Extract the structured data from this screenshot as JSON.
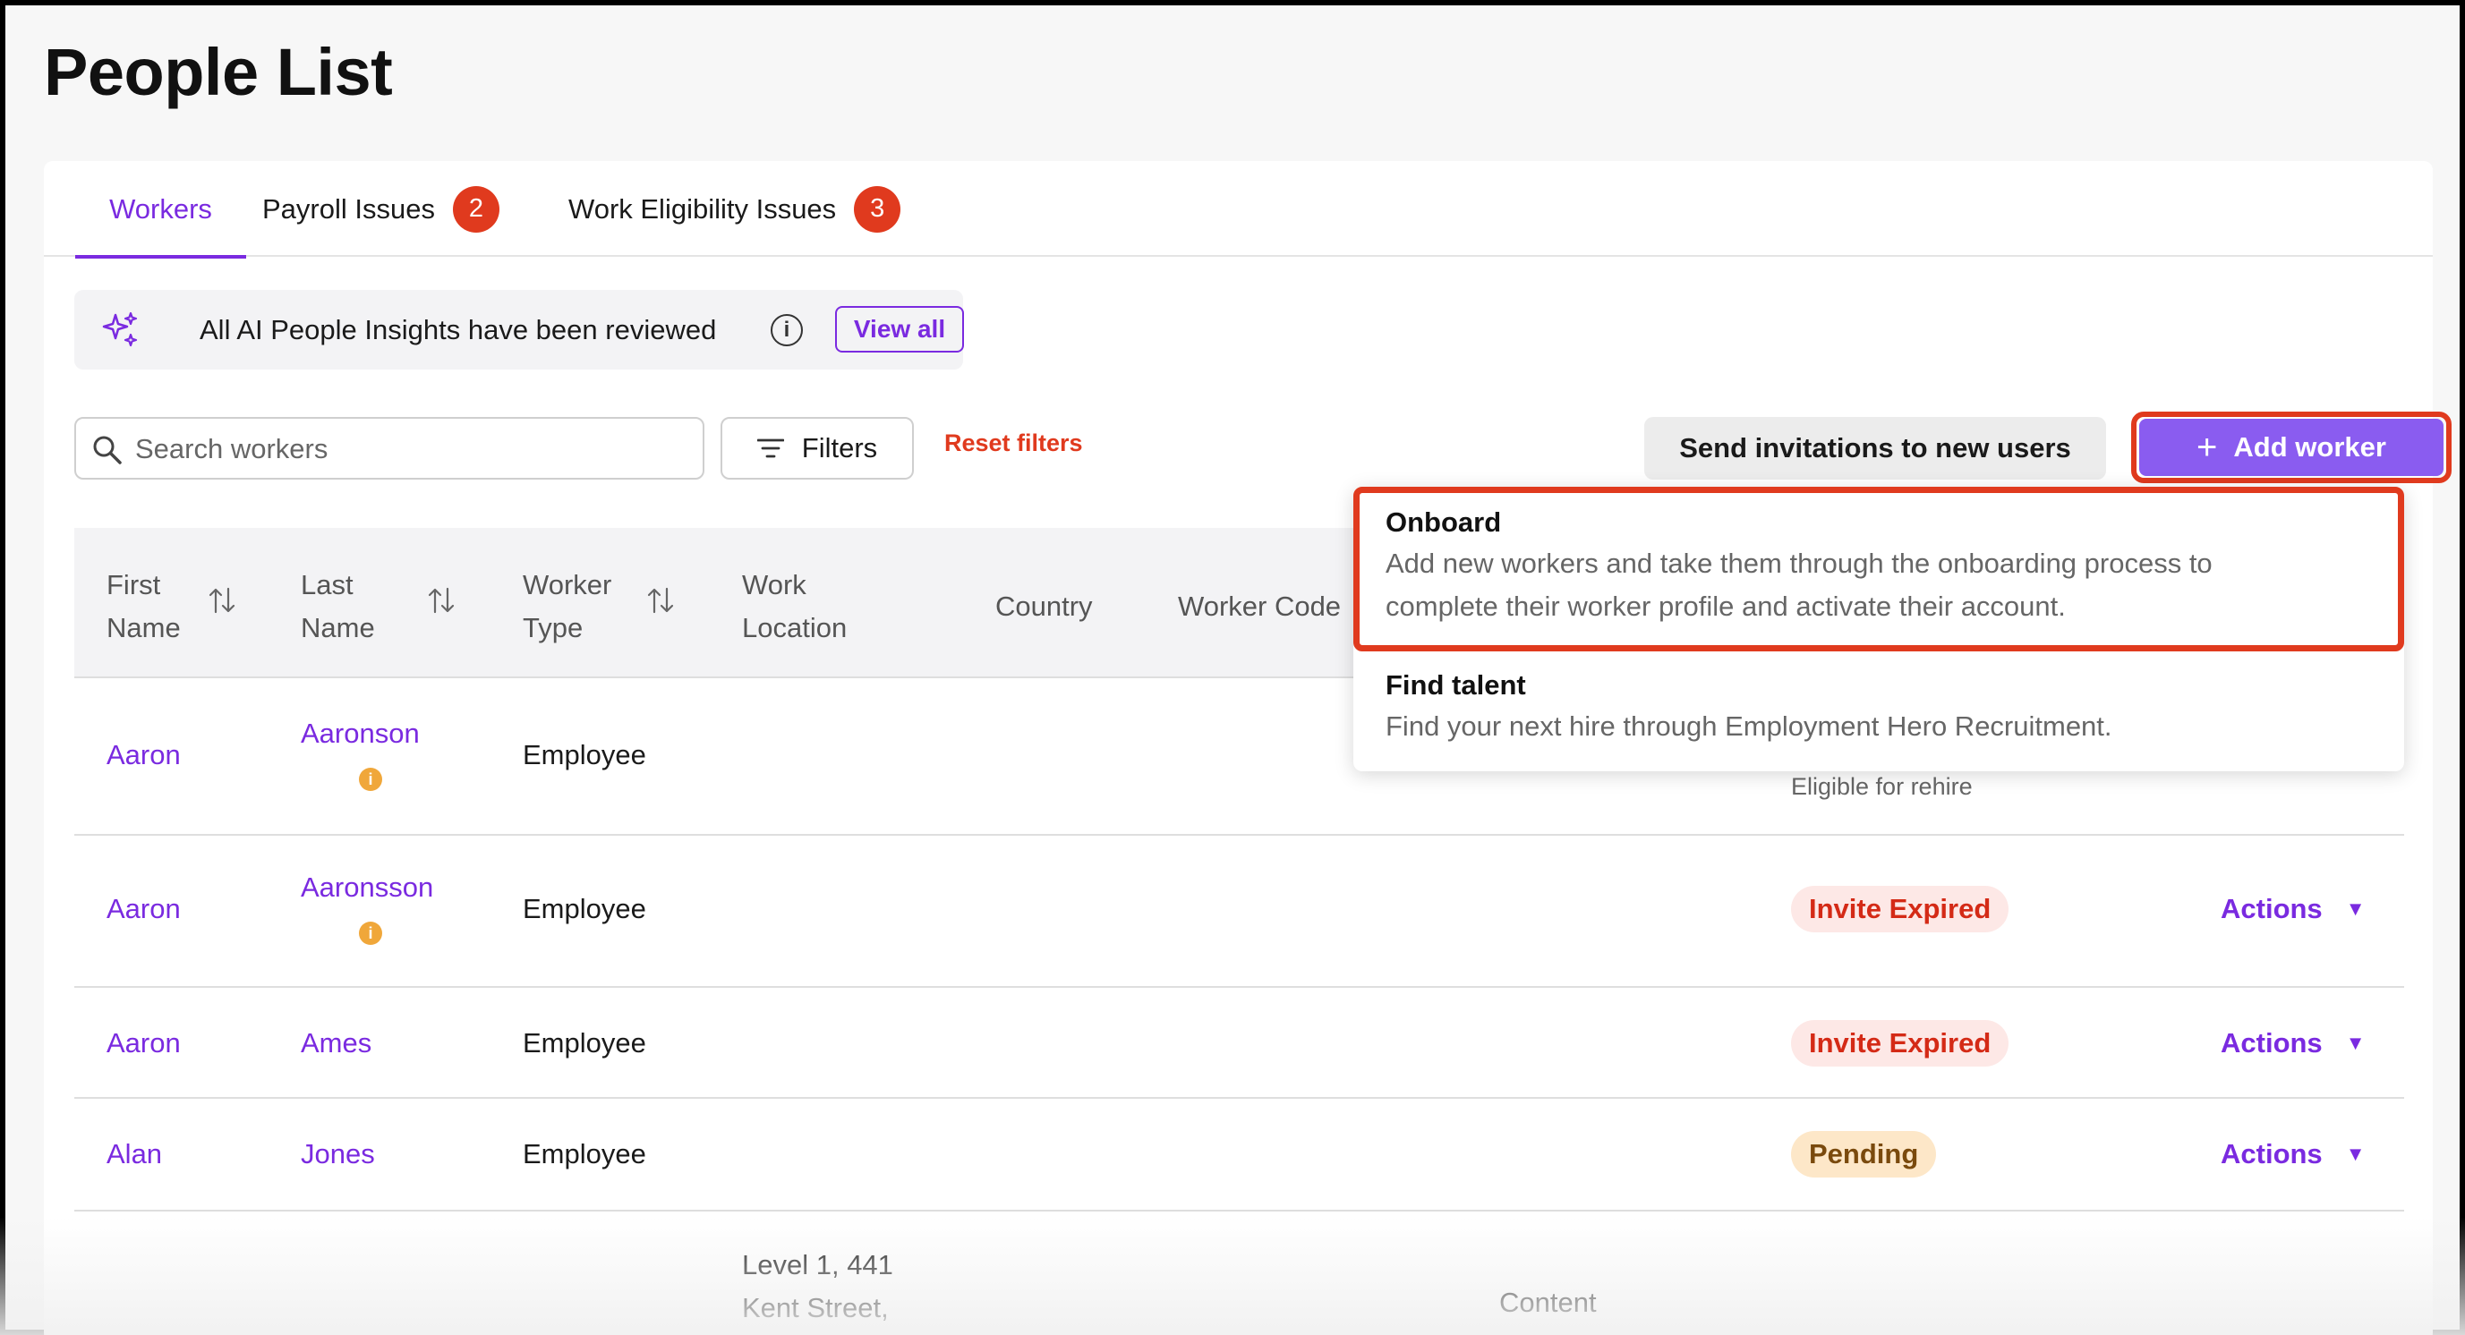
{
  "page_title": "People List",
  "tabs": [
    {
      "label": "Workers",
      "active": true
    },
    {
      "label": "Payroll Issues",
      "badge": "2"
    },
    {
      "label": "Work Eligibility Issues",
      "badge": "3"
    }
  ],
  "insights": {
    "text": "All AI People Insights have been reviewed",
    "info_icon": "info-icon",
    "view_all": "View all"
  },
  "toolbar": {
    "search_placeholder": "Search workers",
    "filters": "Filters",
    "reset_filters": "Reset filters",
    "send_invitations": "Send invitations to new users",
    "add_worker": "Add worker"
  },
  "table": {
    "headers": {
      "first_name": [
        "First",
        "Name"
      ],
      "last_name": [
        "Last",
        "Name"
      ],
      "worker_type": [
        "Worker",
        "Type"
      ],
      "work_location": [
        "Work",
        "Location"
      ],
      "country": "Country",
      "worker_code": "Worker Code"
    },
    "rows": [
      {
        "first": "Aaron",
        "last": "Aaronson",
        "type": "Employee",
        "status_sub": "Eligible for rehire"
      },
      {
        "first": "Aaron",
        "last": "Aaronsson",
        "type": "Employee",
        "status": "Invite Expired",
        "actions": "Actions"
      },
      {
        "first": "Aaron",
        "last": "Ames",
        "type": "Employee",
        "status": "Invite Expired",
        "actions": "Actions"
      },
      {
        "first": "Alan",
        "last": "Jones",
        "type": "Employee",
        "status": "Pending",
        "actions": "Actions"
      },
      {
        "location_line1": "Level 1, 441",
        "location_line2": "Kent Street,",
        "department": "Content"
      }
    ]
  },
  "dropdown": {
    "onboard_title": "Onboard",
    "onboard_desc_1": "Add new workers and take them through the onboarding process to",
    "onboard_desc_2": "complete their worker profile and activate their account.",
    "find_title": "Find talent",
    "find_desc": "Find your next hire through Employment Hero Recruitment."
  },
  "colors": {
    "accent": "#7a2ae0",
    "add_button": "#8a5cf0",
    "highlight": "#e03a1e",
    "badge": "#e03a1e"
  }
}
